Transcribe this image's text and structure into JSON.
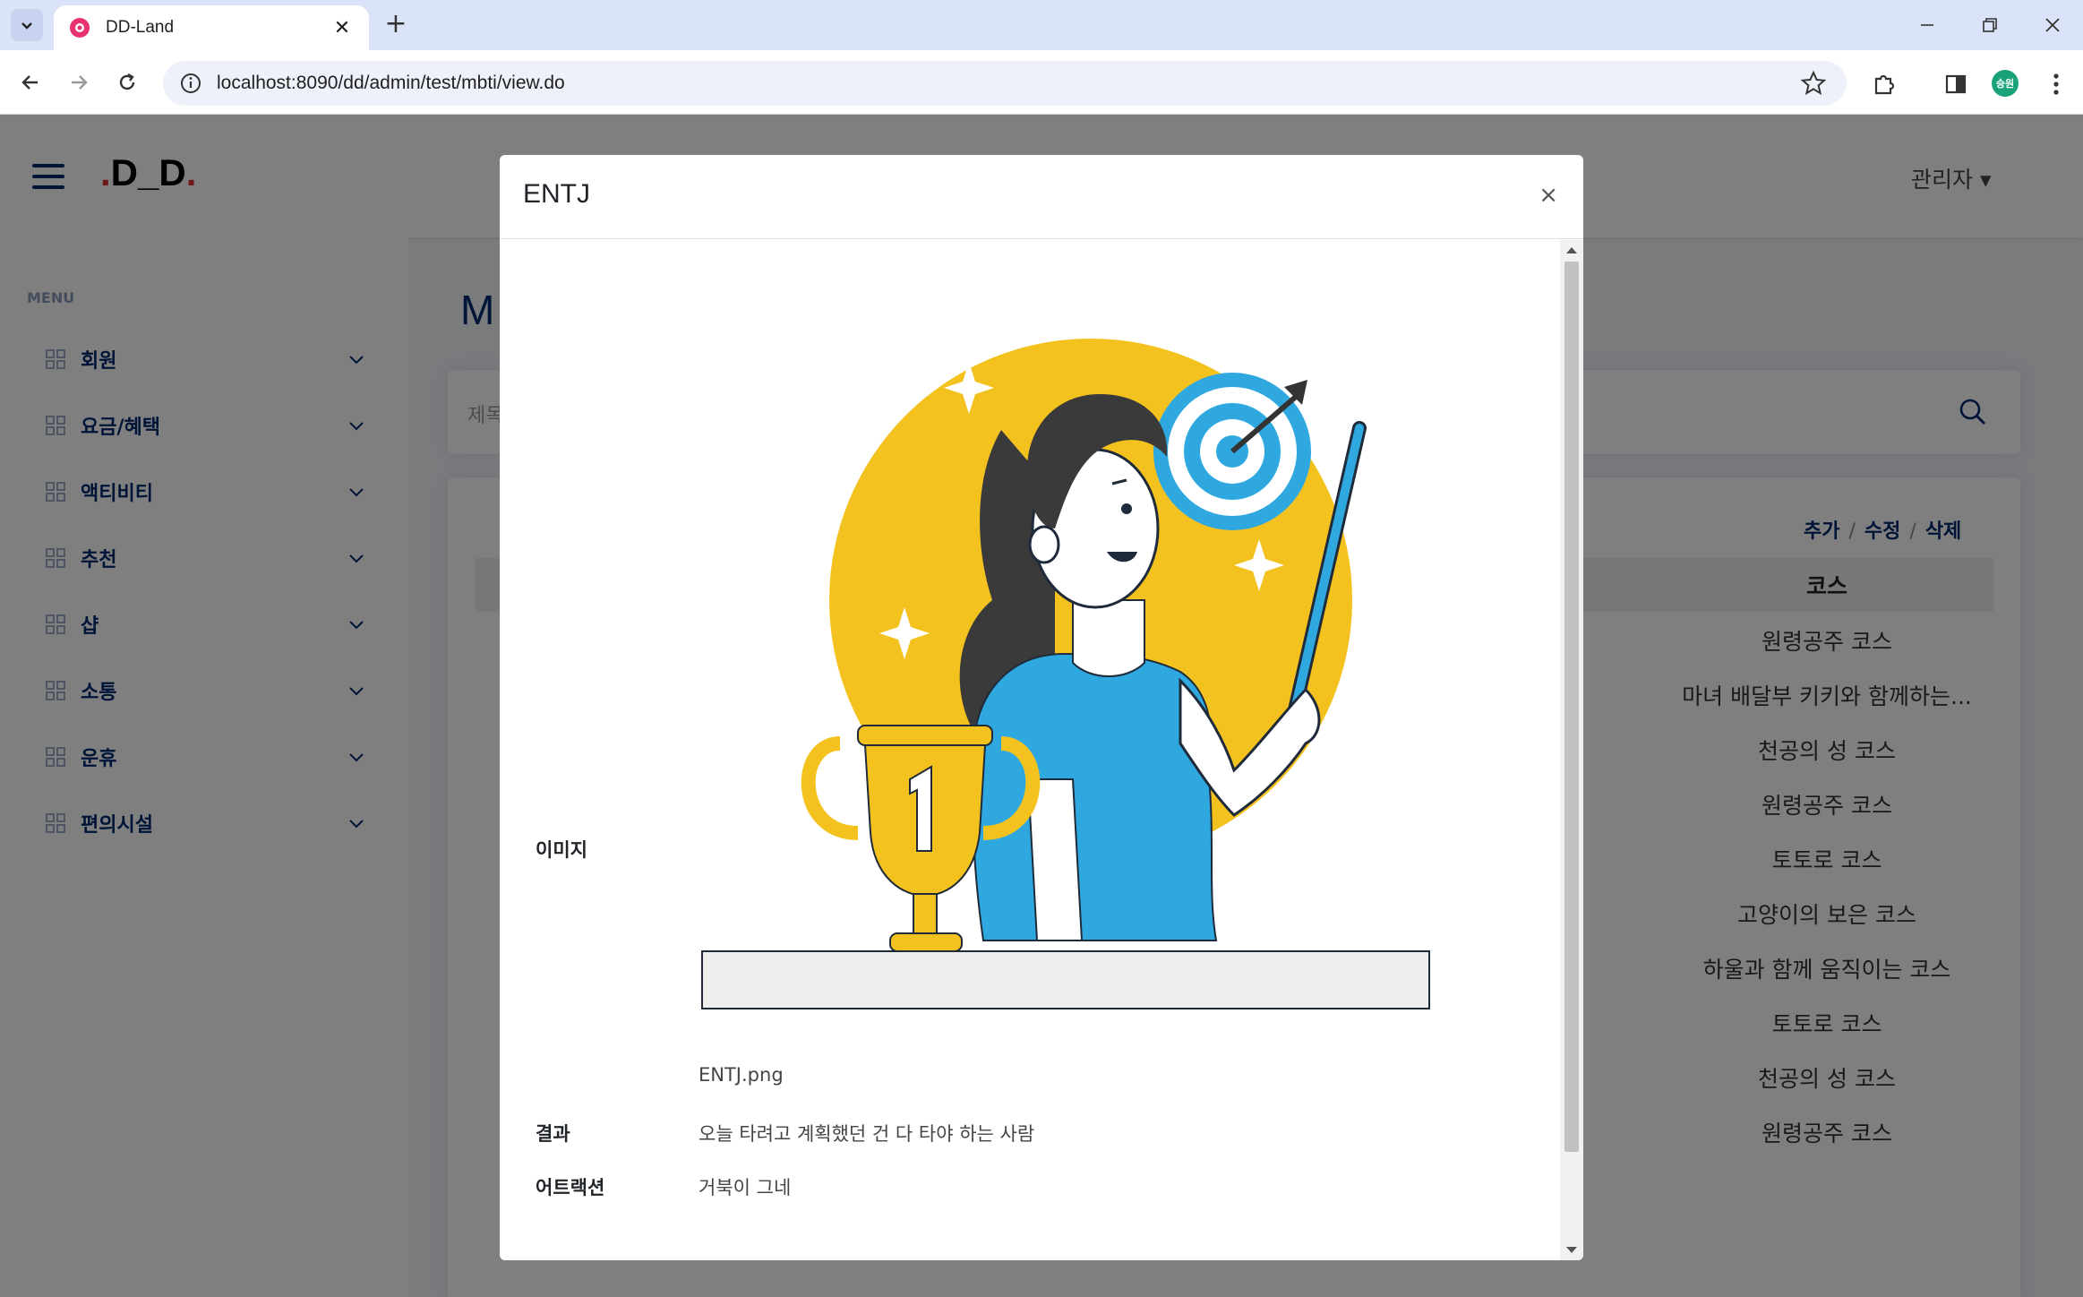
{
  "browser": {
    "tab_title": "DD-Land",
    "url": "localhost:8090/dd/admin/test/mbti/view.do",
    "profile_initials": "승원"
  },
  "header": {
    "logo_prefix": ".",
    "logo_main": "D_D",
    "logo_suffix": ".",
    "admin_label": "관리자"
  },
  "sidebar": {
    "heading": "MENU",
    "items": [
      {
        "label": "회원"
      },
      {
        "label": "요금/혜택"
      },
      {
        "label": "액티비티"
      },
      {
        "label": "추천"
      },
      {
        "label": "샵"
      },
      {
        "label": "소통"
      },
      {
        "label": "운휴"
      },
      {
        "label": "편의시설"
      }
    ]
  },
  "main": {
    "title_initial": "M",
    "search_placeholder": "제목",
    "actions": {
      "add": "추가",
      "edit": "수정",
      "delete": "삭제"
    },
    "table": {
      "column_course": "코스",
      "courses": [
        "원령공주 코스",
        "마녀 배달부 키키와 함께하는...",
        "천공의 성 코스",
        "원령공주 코스",
        "토토로 코스",
        "고양이의 보은 코스",
        "하울과 함께 움직이는 코스",
        "토토로 코스",
        "천공의 성 코스",
        "원령공주 코스"
      ]
    }
  },
  "modal": {
    "title": "ENTJ",
    "close": "×",
    "image_label": "이미지",
    "image_filename": "ENTJ.png",
    "result_label": "결과",
    "result_value": "오늘 타려고 계획했던 건 다 타야 하는 사람",
    "attraction_label": "어트랙션",
    "attraction_value": "거북이 그네"
  },
  "colors": {
    "brand_navy": "#012970",
    "logo_dot": "#e03131",
    "illus_yellow": "#f4c21f",
    "illus_blue": "#2fa8e0"
  }
}
